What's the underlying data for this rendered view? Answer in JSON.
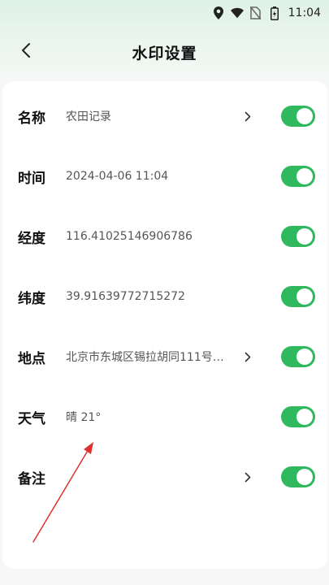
{
  "status_bar": {
    "time": "11:04",
    "icons": [
      "location-icon",
      "wifi-icon",
      "no-sim-icon",
      "battery-icon"
    ]
  },
  "header": {
    "title": "水印设置",
    "back_icon": "chevron-left-icon"
  },
  "rows": [
    {
      "key": "name",
      "label": "名称",
      "value": "农田记录",
      "has_chevron": true,
      "enabled": true
    },
    {
      "key": "time",
      "label": "时间",
      "value": "2024-04-06 11:04",
      "has_chevron": false,
      "enabled": true
    },
    {
      "key": "longitude",
      "label": "经度",
      "value": "116.41025146906786",
      "has_chevron": false,
      "enabled": true
    },
    {
      "key": "latitude",
      "label": "纬度",
      "value": "39.91639772715272",
      "has_chevron": false,
      "enabled": true
    },
    {
      "key": "location",
      "label": "地点",
      "value": "北京市东城区锡拉胡同111号…",
      "has_chevron": true,
      "enabled": true
    },
    {
      "key": "weather",
      "label": "天气",
      "value": "晴 21°",
      "has_chevron": false,
      "enabled": true
    },
    {
      "key": "remark",
      "label": "备注",
      "value": "",
      "has_chevron": true,
      "enabled": true
    }
  ],
  "colors": {
    "toggle_on": "#2fb85e",
    "annotation_arrow": "#e03030"
  }
}
